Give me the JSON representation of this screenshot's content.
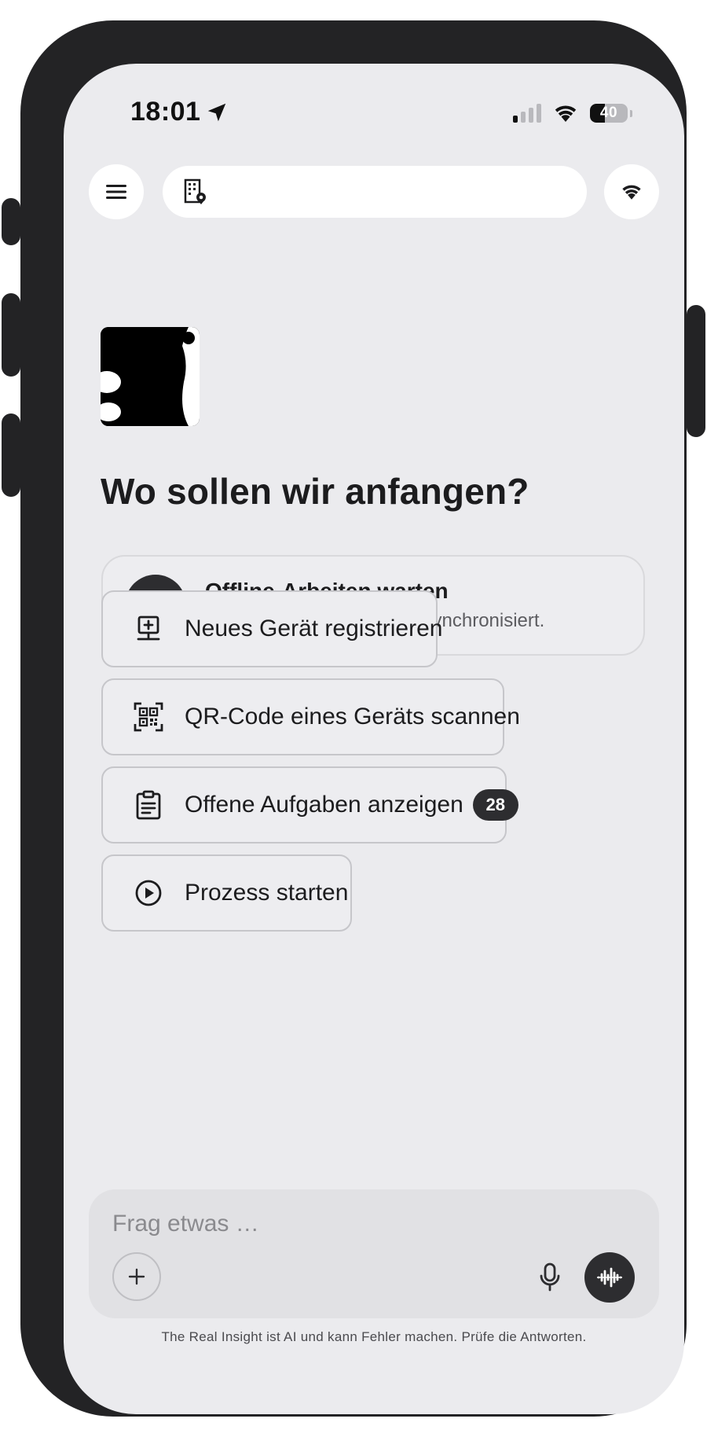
{
  "status_bar": {
    "time": "18:01",
    "location_icon": "location-arrow-icon",
    "signal_icon": "cellular-signal-icon",
    "wifi_icon": "wifi-icon",
    "battery_percent": "40",
    "battery_level": 0.4
  },
  "top_bar": {
    "menu_icon": "hamburger-menu-icon",
    "location_field_icon": "building-location-icon",
    "location_field_value": "",
    "connection_icon": "wifi-icon"
  },
  "logo": {
    "icon": "app-logo"
  },
  "main": {
    "heading": "Wo sollen wir anfangen?",
    "offline_card": {
      "icon": "cloud-upload-icon",
      "title": "Offline-Arbeiten warten",
      "subtitle": "1 Änderung ist noch nicht synchronisiert."
    },
    "actions": [
      {
        "label": "Neues Gerät registrieren",
        "icon": "device-add-icon"
      },
      {
        "label": "QR-Code eines Geräts scannen",
        "icon": "qr-code-scan-icon"
      },
      {
        "label": "Offene Aufgaben anzeigen",
        "icon": "clipboard-icon",
        "badge": "28"
      },
      {
        "label": "Prozess starten",
        "icon": "play-circle-icon"
      }
    ]
  },
  "composer": {
    "placeholder": "Frag etwas …",
    "value": "",
    "attach_icon": "plus-icon",
    "mic_icon": "microphone-icon",
    "voice_icon": "voice-waveform-icon"
  },
  "disclaimer": "The Real Insight ist AI und kann Fehler machen. Prüfe die Antworten.",
  "colors": {
    "screen_background": "#ebebee",
    "frame": "#232325",
    "accent_dark": "#2d2d30",
    "button_border": "#c6c6ca",
    "text_primary": "#1c1c1e",
    "text_secondary": "#5c5c60"
  }
}
